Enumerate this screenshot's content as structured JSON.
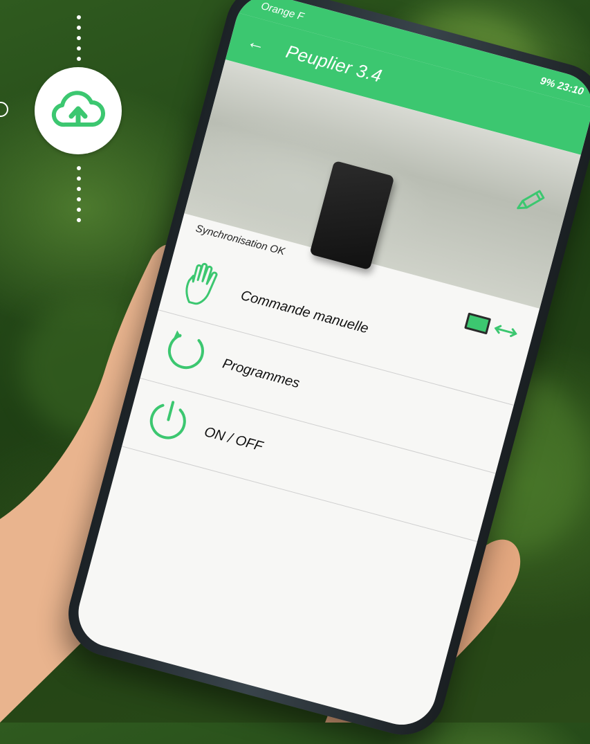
{
  "app": {
    "carrier": "Orange F",
    "status_right": "9% 23:10",
    "title": "Peuplier 3.4",
    "sync_status": "Synchronisation OK"
  },
  "menu": [
    {
      "label": "Commande manuelle",
      "icon": "hand-icon"
    },
    {
      "label": "Programmes",
      "icon": "refresh-icon"
    },
    {
      "label": "ON / OFF",
      "icon": "power-icon"
    }
  ],
  "badge": {
    "icon": "cloud-upload-icon"
  },
  "colors": {
    "accent": "#3cc770",
    "badge": "#ffffff"
  }
}
